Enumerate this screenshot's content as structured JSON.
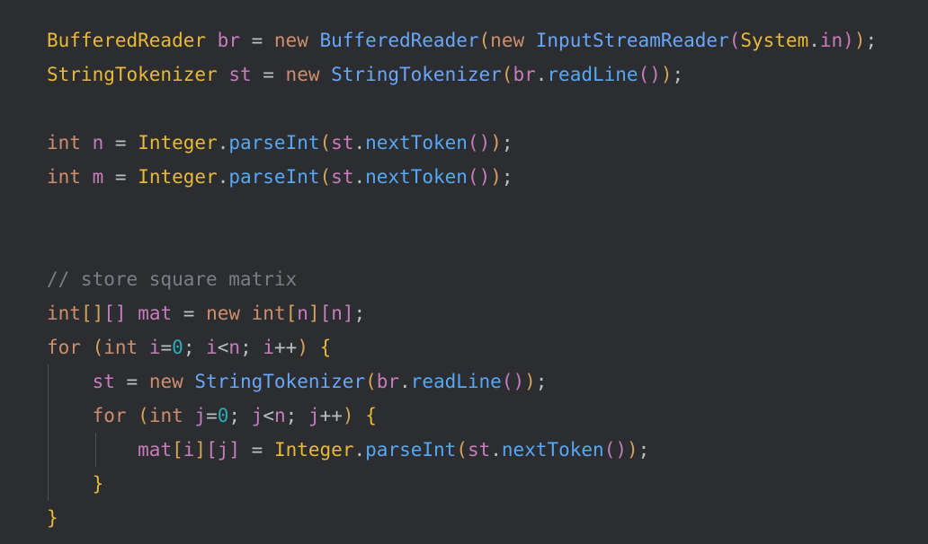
{
  "editor": {
    "lines": [
      [
        [
          "type",
          "BufferedReader"
        ],
        [
          "txt",
          " "
        ],
        [
          "var",
          "br"
        ],
        [
          "op",
          " = "
        ],
        [
          "kw",
          "new"
        ],
        [
          "txt",
          " "
        ],
        [
          "cls2",
          "BufferedReader"
        ],
        [
          "paren",
          "("
        ],
        [
          "kw",
          "new"
        ],
        [
          "txt",
          " "
        ],
        [
          "cls2",
          "InputStreamReader"
        ],
        [
          "paren2",
          "("
        ],
        [
          "type",
          "System"
        ],
        [
          "op",
          "."
        ],
        [
          "var",
          "in"
        ],
        [
          "paren2",
          ")"
        ],
        [
          "paren",
          ")"
        ],
        [
          "op",
          ";"
        ]
      ],
      [
        [
          "type",
          "StringTokenizer"
        ],
        [
          "txt",
          " "
        ],
        [
          "var",
          "st"
        ],
        [
          "op",
          " = "
        ],
        [
          "kw",
          "new"
        ],
        [
          "txt",
          " "
        ],
        [
          "cls2",
          "StringTokenizer"
        ],
        [
          "paren",
          "("
        ],
        [
          "var",
          "br"
        ],
        [
          "op",
          "."
        ],
        [
          "fn",
          "readLine"
        ],
        [
          "paren2",
          "()"
        ],
        [
          "paren",
          ")"
        ],
        [
          "op",
          ";"
        ]
      ],
      [],
      [
        [
          "kw",
          "int"
        ],
        [
          "txt",
          " "
        ],
        [
          "var",
          "n"
        ],
        [
          "op",
          " = "
        ],
        [
          "type",
          "Integer"
        ],
        [
          "op",
          "."
        ],
        [
          "fn",
          "parseInt"
        ],
        [
          "paren",
          "("
        ],
        [
          "var",
          "st"
        ],
        [
          "op",
          "."
        ],
        [
          "fn",
          "nextToken"
        ],
        [
          "paren2",
          "()"
        ],
        [
          "paren",
          ")"
        ],
        [
          "op",
          ";"
        ]
      ],
      [
        [
          "kw",
          "int"
        ],
        [
          "txt",
          " "
        ],
        [
          "var",
          "m"
        ],
        [
          "op",
          " = "
        ],
        [
          "type",
          "Integer"
        ],
        [
          "op",
          "."
        ],
        [
          "fn",
          "parseInt"
        ],
        [
          "paren",
          "("
        ],
        [
          "var",
          "st"
        ],
        [
          "op",
          "."
        ],
        [
          "fn",
          "nextToken"
        ],
        [
          "paren2",
          "()"
        ],
        [
          "paren",
          ")"
        ],
        [
          "op",
          ";"
        ]
      ],
      [],
      [],
      [
        [
          "cmt",
          "// store square matrix"
        ]
      ],
      [
        [
          "kw",
          "int"
        ],
        [
          "paren",
          "[]"
        ],
        [
          "paren2",
          "[]"
        ],
        [
          "txt",
          " "
        ],
        [
          "var",
          "mat"
        ],
        [
          "op",
          " = "
        ],
        [
          "kw",
          "new"
        ],
        [
          "txt",
          " "
        ],
        [
          "kw",
          "int"
        ],
        [
          "paren",
          "["
        ],
        [
          "var",
          "n"
        ],
        [
          "paren",
          "]"
        ],
        [
          "paren2",
          "["
        ],
        [
          "var",
          "n"
        ],
        [
          "paren2",
          "]"
        ],
        [
          "op",
          ";"
        ]
      ],
      [
        [
          "kw",
          "for"
        ],
        [
          "txt",
          " "
        ],
        [
          "paren",
          "("
        ],
        [
          "kw",
          "int"
        ],
        [
          "txt",
          " "
        ],
        [
          "var",
          "i"
        ],
        [
          "op",
          "="
        ],
        [
          "num",
          "0"
        ],
        [
          "op",
          "; "
        ],
        [
          "var",
          "i"
        ],
        [
          "op",
          "<"
        ],
        [
          "var",
          "n"
        ],
        [
          "op",
          "; "
        ],
        [
          "var",
          "i"
        ],
        [
          "op",
          "++"
        ],
        [
          "paren",
          ")"
        ],
        [
          "txt",
          " "
        ],
        [
          "brace",
          "{"
        ]
      ],
      [
        [
          "txt",
          "    "
        ],
        [
          "var",
          "st"
        ],
        [
          "op",
          " = "
        ],
        [
          "kw",
          "new"
        ],
        [
          "txt",
          " "
        ],
        [
          "cls2",
          "StringTokenizer"
        ],
        [
          "paren",
          "("
        ],
        [
          "var",
          "br"
        ],
        [
          "op",
          "."
        ],
        [
          "fn",
          "readLine"
        ],
        [
          "paren2",
          "()"
        ],
        [
          "paren",
          ")"
        ],
        [
          "op",
          ";"
        ]
      ],
      [
        [
          "txt",
          "    "
        ],
        [
          "kw",
          "for"
        ],
        [
          "txt",
          " "
        ],
        [
          "paren",
          "("
        ],
        [
          "kw",
          "int"
        ],
        [
          "txt",
          " "
        ],
        [
          "var",
          "j"
        ],
        [
          "op",
          "="
        ],
        [
          "num",
          "0"
        ],
        [
          "op",
          "; "
        ],
        [
          "var",
          "j"
        ],
        [
          "op",
          "<"
        ],
        [
          "var",
          "n"
        ],
        [
          "op",
          "; "
        ],
        [
          "var",
          "j"
        ],
        [
          "op",
          "++"
        ],
        [
          "paren",
          ")"
        ],
        [
          "txt",
          " "
        ],
        [
          "brace",
          "{"
        ]
      ],
      [
        [
          "txt",
          "        "
        ],
        [
          "var",
          "mat"
        ],
        [
          "paren",
          "["
        ],
        [
          "var",
          "i"
        ],
        [
          "paren",
          "]"
        ],
        [
          "paren2",
          "["
        ],
        [
          "var",
          "j"
        ],
        [
          "paren2",
          "]"
        ],
        [
          "op",
          " = "
        ],
        [
          "type",
          "Integer"
        ],
        [
          "op",
          "."
        ],
        [
          "fn",
          "parseInt"
        ],
        [
          "paren",
          "("
        ],
        [
          "var",
          "st"
        ],
        [
          "op",
          "."
        ],
        [
          "fn",
          "nextToken"
        ],
        [
          "paren2",
          "()"
        ],
        [
          "paren",
          ")"
        ],
        [
          "op",
          ";"
        ]
      ],
      [
        [
          "txt",
          "    "
        ],
        [
          "brace",
          "}"
        ]
      ],
      [
        [
          "brace",
          "}"
        ]
      ]
    ]
  }
}
